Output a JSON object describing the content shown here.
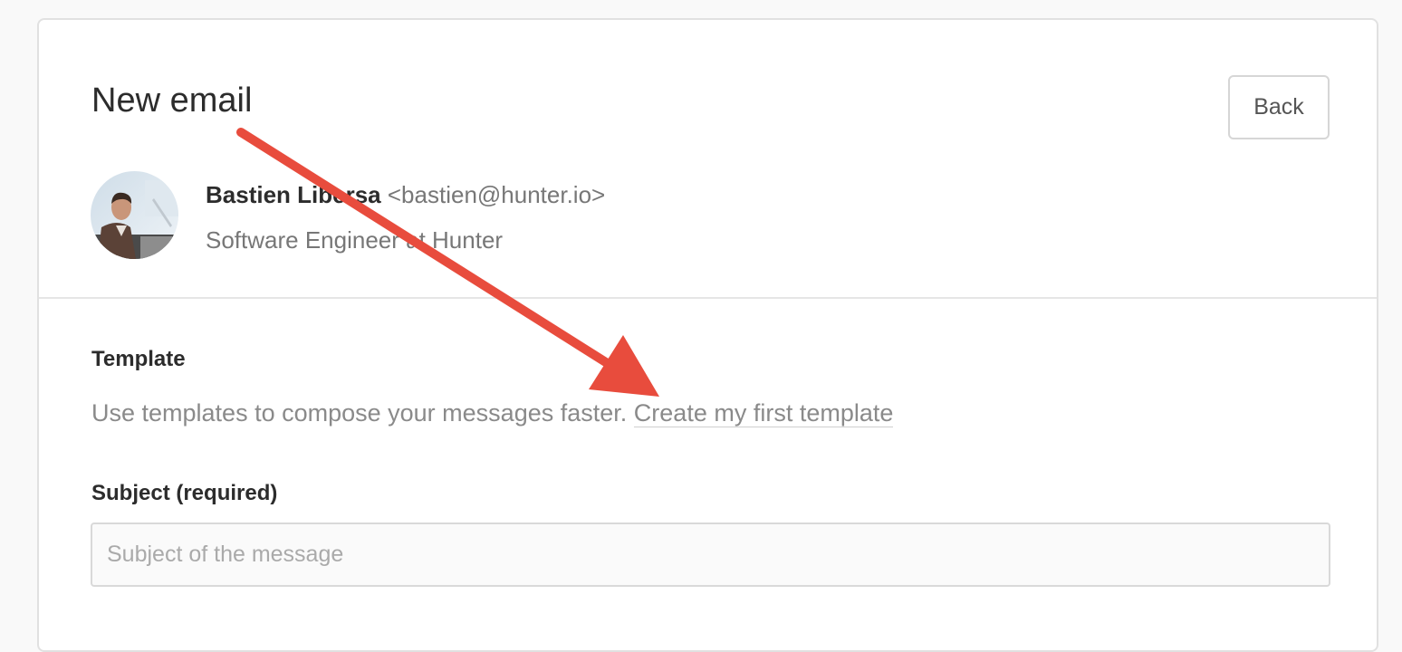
{
  "header": {
    "title": "New email",
    "back_label": "Back"
  },
  "contact": {
    "name": "Bastien Libersa",
    "email": "<bastien@hunter.io>",
    "position": "Software Engineer at Hunter"
  },
  "template": {
    "label": "Template",
    "help_text": "Use templates to compose your messages faster.",
    "link_label": "Create my first template"
  },
  "subject": {
    "label": "Subject (required)",
    "value": "",
    "placeholder": "Subject of the message"
  },
  "colors": {
    "annotation_arrow": "#e84c3d",
    "border": "#e1e1e1",
    "text_primary": "#2c2c2c",
    "text_secondary": "#8a8a8a"
  },
  "icons": {
    "avatar": "person-photo",
    "annotation": "red-arrow-pointer"
  }
}
